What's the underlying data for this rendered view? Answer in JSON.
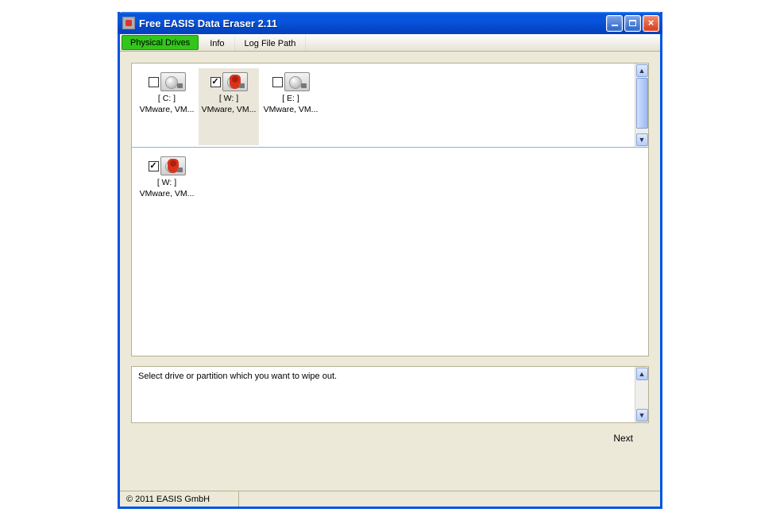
{
  "window": {
    "title": "Free EASIS Data Eraser 2.11"
  },
  "tabs": {
    "physical_drives": "Physical Drives",
    "info": "Info",
    "log_file_path": "Log File Path"
  },
  "drives": {
    "top": [
      {
        "checked": false,
        "marked": false,
        "letter": "[ C: ]",
        "desc": "VMware, VM..."
      },
      {
        "checked": true,
        "marked": true,
        "letter": "[ W: ]",
        "desc": "VMware, VM...",
        "highlight": true
      },
      {
        "checked": false,
        "marked": false,
        "letter": "[ E: ]",
        "desc": "VMware, VM..."
      }
    ],
    "selected": [
      {
        "checked": true,
        "marked": true,
        "letter": "[ W: ]",
        "desc": "VMware, VM..."
      }
    ]
  },
  "message": "Select drive or partition which you want to wipe out.",
  "buttons": {
    "next": "Next"
  },
  "status": {
    "copyright": "© 2011 EASIS GmbH"
  },
  "glyphs": {
    "check": "☑",
    "uncheck": "",
    "up": "▲",
    "down": "▼"
  }
}
